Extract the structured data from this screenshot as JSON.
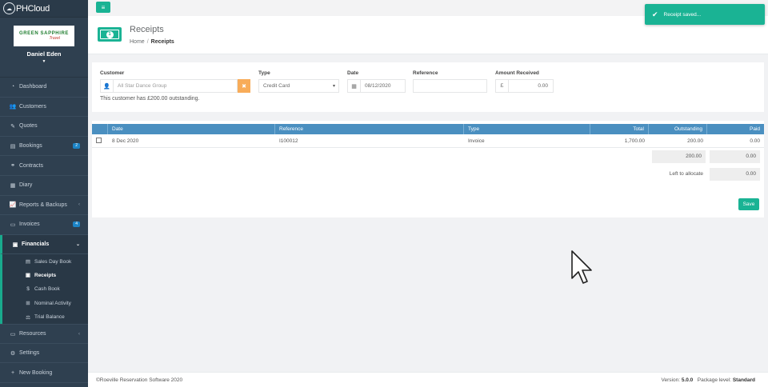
{
  "brand": {
    "name": "PHCloud"
  },
  "profile": {
    "logo_line1": "GREEN SAPPHIRE",
    "logo_line2": "Travel",
    "user": "Daniel Eden"
  },
  "nav": {
    "dashboard": "Dashboard",
    "customers": "Customers",
    "quotes": "Quotes",
    "bookings": "Bookings",
    "bookings_badge": "2",
    "contracts": "Contracts",
    "diary": "Diary",
    "reports": "Reports & Backups",
    "invoices": "Invoices",
    "invoices_badge": "4",
    "financials": "Financials",
    "sub": {
      "sales_day_book": "Sales Day Book",
      "receipts": "Receipts",
      "cash_book": "Cash Book",
      "nominal_activity": "Nominal Activity",
      "trial_balance": "Trial Balance"
    },
    "resources": "Resources",
    "settings": "Settings",
    "new_booking": "New Booking"
  },
  "toast": {
    "message": "Receipt saved..."
  },
  "heading": {
    "title": "Receipts",
    "crumb_home": "Home",
    "crumb_current": "Receipts"
  },
  "form": {
    "customer_label": "Customer",
    "customer_value": "All Star Dance Group",
    "type_label": "Type",
    "type_value": "Credit Card",
    "date_label": "Date",
    "date_value": "08/12/2020",
    "reference_label": "Reference",
    "reference_value": "",
    "amount_label": "Amount Received",
    "currency_symbol": "£",
    "amount_value": "0.00",
    "note": "This customer has £200.00 outstanding."
  },
  "table": {
    "headers": {
      "date": "Date",
      "reference": "Reference",
      "type": "Type",
      "total": "Total",
      "outstanding": "Outstanding",
      "paid": "Paid"
    },
    "rows": [
      {
        "date": "8 Dec 2020",
        "reference": "I100012",
        "type": "Invoice",
        "total": "1,700.00",
        "outstanding": "200.00",
        "paid": "0.00"
      }
    ],
    "sum_outstanding": "200.00",
    "sum_paid": "0.00",
    "left_label": "Left to allocate",
    "left_value": "0.00",
    "save_label": "Save"
  },
  "footer": {
    "copyright": "©Roeville Reservation Software 2020",
    "version_label": "Version:",
    "version_value": "5.0.0",
    "package_label": "Package level:",
    "package_value": "Standard"
  },
  "colors": {
    "accent": "#1ab394",
    "sidebar": "#2f4050",
    "table_header": "#4a8fc0",
    "warning": "#f8ac59"
  }
}
